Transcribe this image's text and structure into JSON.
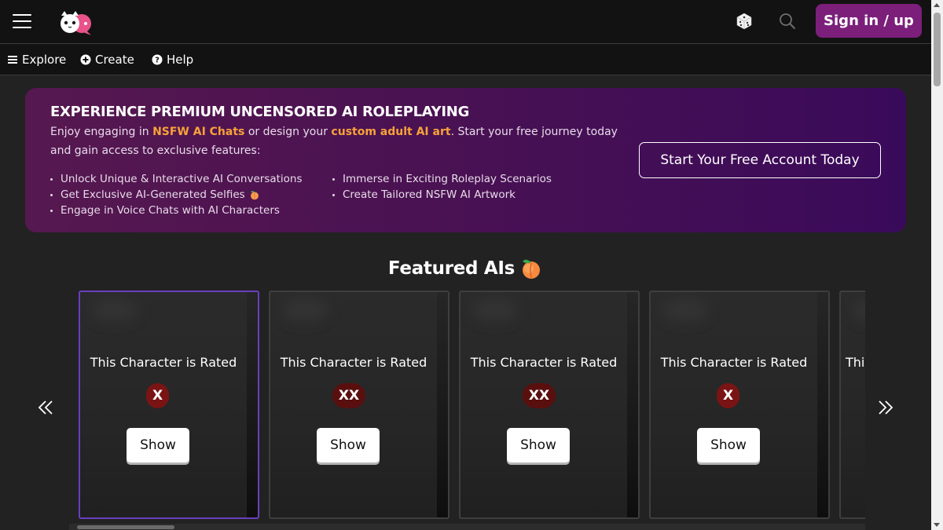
{
  "header": {
    "menu_icon": "hamburger-menu-icon",
    "logo_icon": "cat-chat-logo",
    "dice_icon": "dice-icon",
    "search_icon": "search-icon",
    "signin_label": "Sign in / up",
    "signin_color": "#7b1f7b"
  },
  "nav": {
    "items": [
      {
        "label": "Explore",
        "icon": "list-icon"
      },
      {
        "label": "Create",
        "icon": "plus-circle-icon"
      },
      {
        "label": "Help",
        "icon": "question-circle-icon"
      }
    ]
  },
  "promo": {
    "title": "EXPERIENCE PREMIUM UNCENSORED AI ROLEPLAYING",
    "desc_1": "Enjoy engaging in ",
    "highlight_1": "NSFW AI Chats",
    "desc_2": " or design your ",
    "highlight_2": "custom adult AI art",
    "desc_3": ". Start your free journey today and gain access to exclusive features:",
    "highlight_color": "#f7a23a",
    "features": [
      "Unlock Unique & Interactive AI Conversations",
      "Get Exclusive AI-Generated Selfies",
      "Engage in Voice Chats with AI Characters",
      "Immerse in Exciting Roleplay Scenarios",
      "Create Tailored NSFW AI Artwork"
    ],
    "cta_label": "Start Your Free Account Today"
  },
  "featured": {
    "title": "Featured AIs",
    "title_icon": "peach-icon",
    "cards": [
      {
        "text": "This Character is Rated",
        "rating": "X",
        "button": "Show"
      },
      {
        "text": "This Character is Rated",
        "rating": "XX",
        "button": "Show"
      },
      {
        "text": "This Character is Rated",
        "rating": "XX",
        "button": "Show"
      },
      {
        "text": "This Character is Rated",
        "rating": "X",
        "button": "Show"
      },
      {
        "text": "This Character is Rated",
        "rating": "",
        "button": ""
      }
    ],
    "prev_icon": "double-chevron-left-icon",
    "next_icon": "double-chevron-right-icon"
  }
}
